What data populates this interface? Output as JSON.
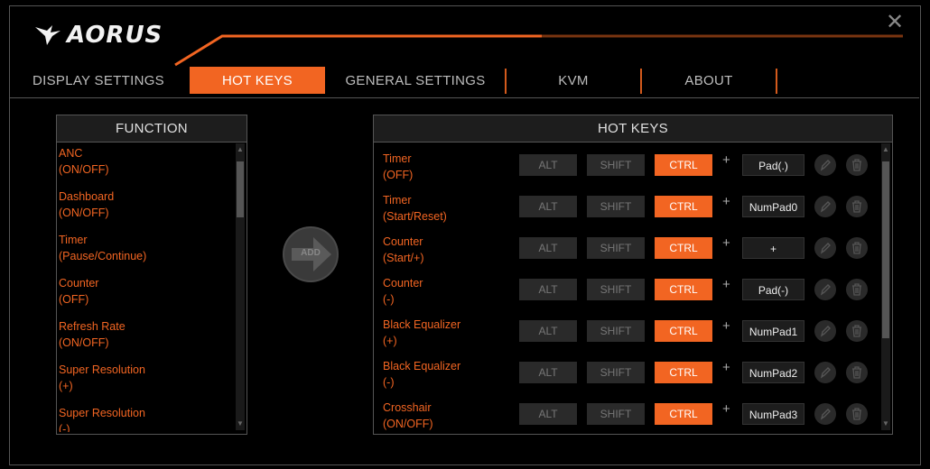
{
  "app": {
    "brand": "AORUS"
  },
  "tabs": [
    {
      "label": "DISPLAY SETTINGS",
      "active": false
    },
    {
      "label": "HOT KEYS",
      "active": true
    },
    {
      "label": "GENERAL SETTINGS",
      "active": false
    },
    {
      "label": "KVM",
      "active": false
    },
    {
      "label": "ABOUT",
      "active": false
    }
  ],
  "function_panel": {
    "title": "FUNCTION",
    "items": [
      {
        "line1": "ANC",
        "line2": "(ON/OFF)"
      },
      {
        "line1": "Dashboard",
        "line2": "(ON/OFF)"
      },
      {
        "line1": "Timer",
        "line2": "(Pause/Continue)"
      },
      {
        "line1": "Counter",
        "line2": "(OFF)"
      },
      {
        "line1": "Refresh Rate",
        "line2": "(ON/OFF)"
      },
      {
        "line1": "Super Resolution",
        "line2": "(+)"
      },
      {
        "line1": "Super Resolution",
        "line2": "(-)"
      }
    ]
  },
  "add_button": {
    "label": "ADD"
  },
  "hotkeys_panel": {
    "title": "HOT KEYS",
    "plus": "+",
    "modifiers": {
      "alt": "ALT",
      "shift": "SHIFT",
      "ctrl": "CTRL"
    },
    "rows": [
      {
        "line1": "Timer",
        "line2": "(OFF)",
        "key": "Pad(.)"
      },
      {
        "line1": "Timer",
        "line2": "(Start/Reset)",
        "key": "NumPad0"
      },
      {
        "line1": "Counter",
        "line2": "(Start/+)",
        "key": "+"
      },
      {
        "line1": "Counter",
        "line2": "(-)",
        "key": "Pad(-)"
      },
      {
        "line1": "Black Equalizer",
        "line2": "(+)",
        "key": "NumPad1"
      },
      {
        "line1": "Black Equalizer",
        "line2": "(-)",
        "key": "NumPad2"
      },
      {
        "line1": "Crosshair",
        "line2": "(ON/OFF)",
        "key": "NumPad3"
      }
    ]
  },
  "colors": {
    "accent": "#f26522",
    "background": "#000000",
    "border": "#555555"
  },
  "icons": {
    "close": "close-icon",
    "edit": "pencil-icon",
    "delete": "trash-icon",
    "add": "arrow-right-icon",
    "logo": "eagle-logo-icon"
  }
}
